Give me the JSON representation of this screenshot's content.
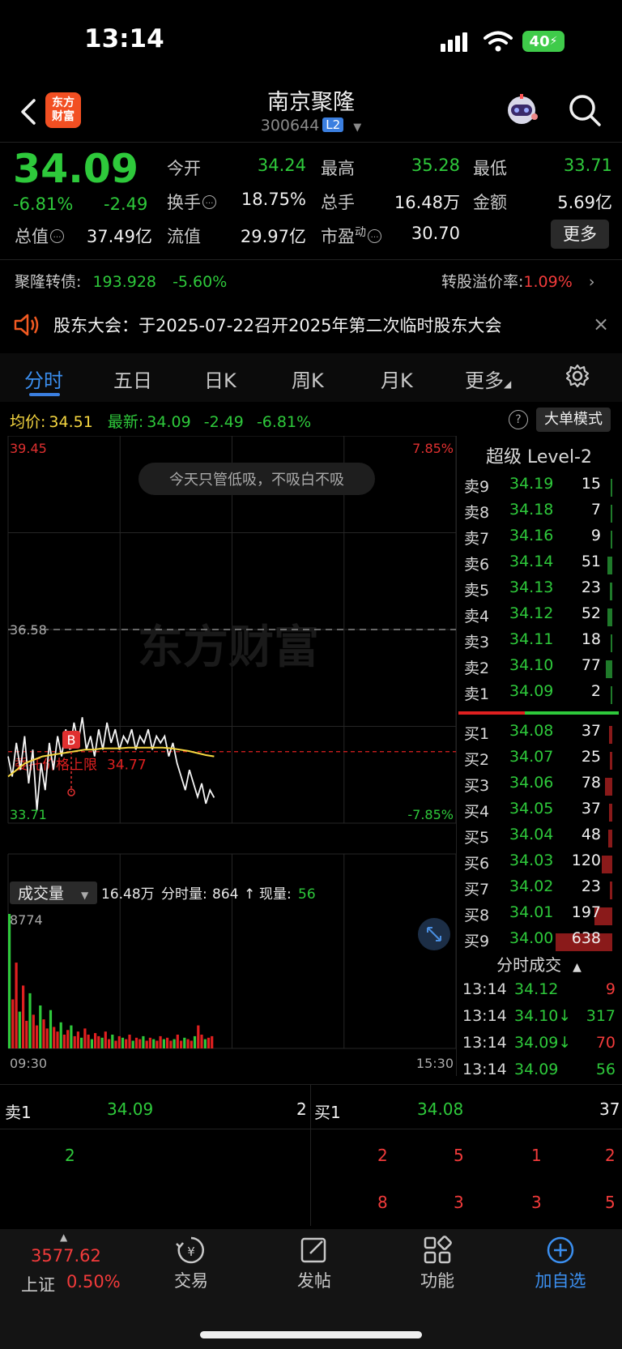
{
  "status_bar": {
    "time": "13:14",
    "battery": "40"
  },
  "header": {
    "title": "南京聚隆",
    "code": "300644",
    "level_badge": "L2",
    "logo_line1": "东方",
    "logo_line2": "财富"
  },
  "quote": {
    "price": "34.09",
    "change_pct": "-6.81%",
    "change_amt": "-2.49",
    "open_label": "今开",
    "open": "34.24",
    "high_label": "最高",
    "high": "35.28",
    "low_label": "最低",
    "low": "33.71",
    "turnover_label": "换手",
    "turnover": "18.75%",
    "volume_label": "总手",
    "volume": "16.48万",
    "amount_label": "金额",
    "amount": "5.69亿",
    "mktcap_label": "总值",
    "mktcap": "37.49亿",
    "float_label": "流值",
    "float": "29.97亿",
    "pe_label": "市盈",
    "pe_sup": "动",
    "pe": "30.70",
    "more_label": "更多"
  },
  "convertible": {
    "label": "聚隆转债:",
    "price": "193.928",
    "change": "-5.60%",
    "premium_label": "转股溢价率:",
    "premium": "1.09%"
  },
  "notice": {
    "text": "股东大会：于2025-07-22召开2025年第二次临时股东大会",
    "close": "×"
  },
  "tabs": [
    {
      "label": "分时"
    },
    {
      "label": "五日"
    },
    {
      "label": "日K"
    },
    {
      "label": "周K"
    },
    {
      "label": "月K"
    },
    {
      "label": "更多"
    }
  ],
  "chart_info": {
    "avg_label": "均价:",
    "avg": "34.51",
    "latest_label": "最新:",
    "latest": "34.09",
    "chg": "-2.49",
    "pct": "-6.81%",
    "help": "?",
    "big_order": "大单模式"
  },
  "chart_labels": {
    "y_top": "39.45",
    "y_mid": "36.58",
    "y_bot": "33.71",
    "pct_top": "7.85%",
    "pct_bot": "-7.85%",
    "tip": "今天只管低吸，不吸白不吸",
    "watermark": "东方财富",
    "buy_marker": "B",
    "stop_label": "委托价格上限",
    "stop_price": "34.77",
    "vol_selector": "成交量",
    "vol_total": "16.48万",
    "vol_minute_label": "分时量:",
    "vol_minute": "864",
    "vol_now_label": "现量:",
    "vol_now": "56",
    "vol_max": "8774",
    "x_start": "09:30",
    "x_end": "15:30"
  },
  "level2": {
    "title": "超级 Level-2",
    "asks": [
      {
        "label": "卖9",
        "price": "34.19",
        "vol": "15"
      },
      {
        "label": "卖8",
        "price": "34.18",
        "vol": "7"
      },
      {
        "label": "卖7",
        "price": "34.16",
        "vol": "9"
      },
      {
        "label": "卖6",
        "price": "34.14",
        "vol": "51"
      },
      {
        "label": "卖5",
        "price": "34.13",
        "vol": "23"
      },
      {
        "label": "卖4",
        "price": "34.12",
        "vol": "52"
      },
      {
        "label": "卖3",
        "price": "34.11",
        "vol": "18"
      },
      {
        "label": "卖2",
        "price": "34.10",
        "vol": "77"
      },
      {
        "label": "卖1",
        "price": "34.09",
        "vol": "2"
      }
    ],
    "bids": [
      {
        "label": "买1",
        "price": "34.08",
        "vol": "37"
      },
      {
        "label": "买2",
        "price": "34.07",
        "vol": "25"
      },
      {
        "label": "买3",
        "price": "34.06",
        "vol": "78"
      },
      {
        "label": "买4",
        "price": "34.05",
        "vol": "37"
      },
      {
        "label": "买5",
        "price": "34.04",
        "vol": "48"
      },
      {
        "label": "买6",
        "price": "34.03",
        "vol": "120"
      },
      {
        "label": "买7",
        "price": "34.02",
        "vol": "23"
      },
      {
        "label": "买8",
        "price": "34.01",
        "vol": "197"
      },
      {
        "label": "买9",
        "price": "34.00",
        "vol": "638"
      }
    ],
    "trades_title": "分时成交",
    "trades": [
      {
        "time": "13:14",
        "price": "34.12",
        "vol": "9"
      },
      {
        "time": "13:14",
        "price": "34.10↓",
        "vol": "317"
      },
      {
        "time": "13:14",
        "price": "34.09↓",
        "vol": "70"
      },
      {
        "time": "13:14",
        "price": "34.09",
        "vol": "56"
      }
    ]
  },
  "order_summary": {
    "ask_label": "卖1",
    "ask_price": "34.09",
    "ask_vol": "2",
    "bid_label": "买1",
    "bid_price": "34.08",
    "bid_vol": "37",
    "ask_queue": [
      "2"
    ],
    "bid_queue": [
      "2",
      "5",
      "1",
      "2",
      "8",
      "3",
      "3",
      "5"
    ]
  },
  "bottom_nav": {
    "index_value": "3577.62",
    "index_name": "上证",
    "index_pct": "0.50%",
    "items": [
      {
        "label": "交易"
      },
      {
        "label": "发帖"
      },
      {
        "label": "功能"
      },
      {
        "label": "加自选"
      }
    ]
  },
  "chart_data": {
    "type": "line",
    "x_range": [
      "09:30",
      "15:30"
    ],
    "ylim": [
      33.71,
      39.45
    ],
    "reference": 36.58,
    "stop_price": 34.77,
    "price_series": [
      34.7,
      34.4,
      34.9,
      34.5,
      35.0,
      34.3,
      34.8,
      33.9,
      34.6,
      34.2,
      34.9,
      34.5,
      35.0,
      34.7,
      35.1,
      34.8,
      35.2,
      34.9,
      35.28,
      34.8,
      35.0,
      34.7,
      35.1,
      34.8,
      35.2,
      34.9,
      35.1,
      34.8,
      35.0,
      34.9,
      35.1,
      34.8,
      35.0,
      34.9,
      35.1,
      34.8,
      35.0,
      34.9,
      35.0,
      34.7,
      34.9,
      34.6,
      34.4,
      34.2,
      34.5,
      34.3,
      34.1,
      34.3,
      34.0,
      34.2,
      34.09
    ],
    "avg_series": [
      34.4,
      34.5,
      34.6,
      34.65,
      34.7,
      34.72,
      34.74,
      34.76,
      34.78,
      34.8,
      34.8,
      34.82,
      34.82,
      34.82,
      34.83,
      34.83,
      34.83,
      34.83,
      34.83,
      34.82,
      34.8,
      34.78,
      34.75,
      34.72,
      34.7
    ],
    "volume_max": 8774,
    "volume_series": [
      8774,
      3200,
      5600,
      2400,
      4100,
      1800,
      3600,
      2200,
      1500,
      2800,
      1900,
      1300,
      2500,
      1400,
      1100,
      1700,
      900,
      1200,
      1500,
      800,
      1100,
      700,
      1300,
      900,
      600,
      1000,
      800,
      700,
      1100,
      600,
      900,
      500,
      800,
      700,
      600,
      900,
      500,
      700,
      600,
      800,
      500,
      700,
      600,
      500,
      800,
      600,
      700,
      500,
      600,
      900,
      500,
      700,
      600,
      500,
      800,
      1500,
      900,
      600,
      700,
      800
    ]
  }
}
